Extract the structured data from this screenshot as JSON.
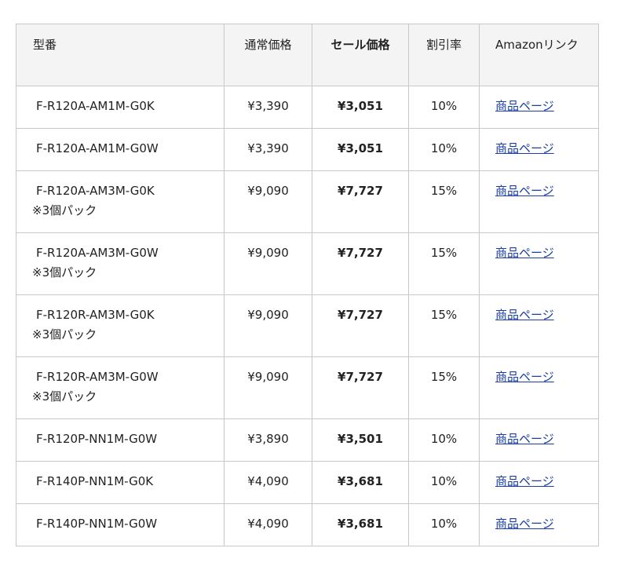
{
  "header": {
    "model": "型番",
    "regular_price": "通常価格",
    "sale_price": "セール価格",
    "discount": "割引率",
    "link": "Amazonリンク"
  },
  "rows": [
    {
      "model": "F-R120A-AM1M-G0K",
      "note": "",
      "regular": "¥3,390",
      "sale": "¥3,051",
      "discount": "10%",
      "link": "商品ページ"
    },
    {
      "model": "F-R120A-AM1M-G0W",
      "note": "",
      "regular": "¥3,390",
      "sale": "¥3,051",
      "discount": "10%",
      "link": "商品ページ"
    },
    {
      "model": "F-R120A-AM3M-G0K",
      "note": "※3個パック",
      "regular": "¥9,090",
      "sale": "¥7,727",
      "discount": "15%",
      "link": "商品ページ"
    },
    {
      "model": "F-R120A-AM3M-G0W",
      "note": "※3個パック",
      "regular": "¥9,090",
      "sale": "¥7,727",
      "discount": "15%",
      "link": "商品ページ"
    },
    {
      "model": "F-R120R-AM3M-G0K",
      "note": "※3個パック",
      "regular": "¥9,090",
      "sale": "¥7,727",
      "discount": "15%",
      "link": "商品ページ"
    },
    {
      "model": "F-R120R-AM3M-G0W",
      "note": "※3個パック",
      "regular": "¥9,090",
      "sale": "¥7,727",
      "discount": "15%",
      "link": "商品ページ"
    },
    {
      "model": "F-R120P-NN1M-G0W",
      "note": "",
      "regular": "¥3,890",
      "sale": "¥3,501",
      "discount": "10%",
      "link": "商品ページ"
    },
    {
      "model": "F-R140P-NN1M-G0K",
      "note": "",
      "regular": "¥4,090",
      "sale": "¥3,681",
      "discount": "10%",
      "link": "商品ページ"
    },
    {
      "model": "F-R140P-NN1M-G0W",
      "note": "",
      "regular": "¥4,090",
      "sale": "¥3,681",
      "discount": "10%",
      "link": "商品ページ"
    }
  ]
}
